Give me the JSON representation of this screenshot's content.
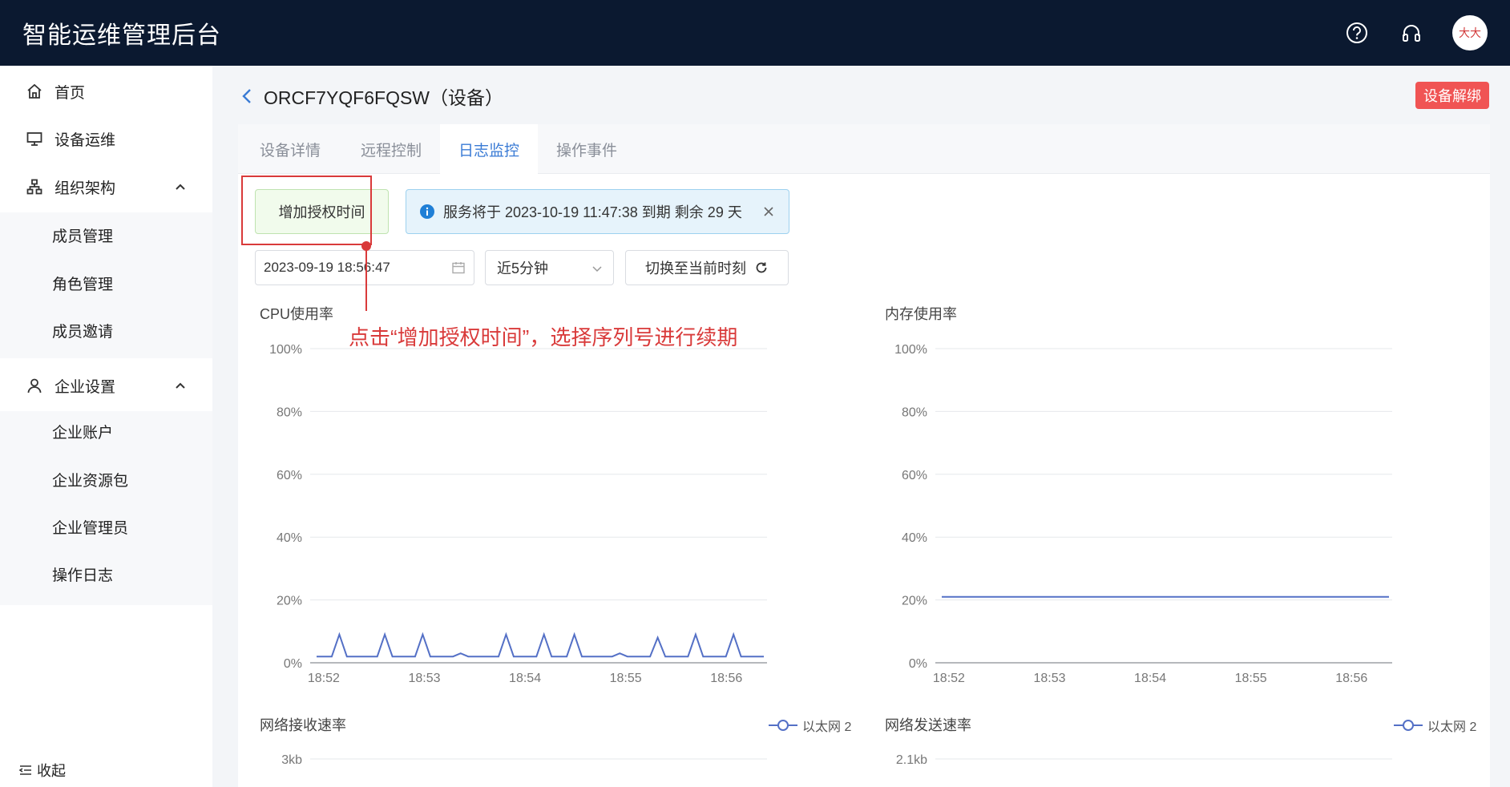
{
  "app": {
    "title": "智能运维管理后台",
    "avatar_text": "大大"
  },
  "topbar": {
    "icons": [
      "help-icon",
      "headset-icon"
    ]
  },
  "sidebar": {
    "items": [
      {
        "label": "首页",
        "icon": "home-icon"
      },
      {
        "label": "设备运维",
        "icon": "monitor-icon"
      },
      {
        "label": "组织架构",
        "icon": "org-icon",
        "expanded": true
      },
      {
        "label": "企业设置",
        "icon": "user-icon",
        "expanded": true
      }
    ],
    "org_children": [
      "成员管理",
      "角色管理",
      "成员邀请"
    ],
    "ent_children": [
      "企业账户",
      "企业资源包",
      "企业管理员",
      "操作日志"
    ],
    "collapse_label": "收起"
  },
  "header": {
    "title": "ORCF7YQF6FQSW（设备）",
    "unbind_label": "设备解绑"
  },
  "tabs": [
    {
      "label": "设备详情",
      "active": false
    },
    {
      "label": "远程控制",
      "active": false
    },
    {
      "label": "日志监控",
      "active": true
    },
    {
      "label": "操作事件",
      "active": false
    }
  ],
  "toolbar": {
    "add_auth_label": "增加授权时间",
    "notice_text": "服务将于 2023-10-19 11:47:38 到期 剩余 29 天",
    "date_value": "2023-09-19 18:56:47",
    "range_value": "近5分钟",
    "switch_label": "切换至当前时刻"
  },
  "annotation": {
    "text": "点击“增加授权时间”，选择序列号进行续期"
  },
  "chart_data": [
    {
      "type": "line",
      "title": "CPU使用率",
      "yticks": [
        "100%",
        "80%",
        "60%",
        "40%",
        "20%",
        "0%"
      ],
      "xticks": [
        "18:52",
        "18:53",
        "18:54",
        "18:55",
        "18:56"
      ],
      "ylim": [
        0,
        100
      ],
      "x": [
        "18:51:50",
        "18:51:55",
        "18:52:00",
        "18:52:05",
        "18:52:10",
        "18:52:15",
        "18:52:20",
        "18:52:25",
        "18:52:30",
        "18:52:35",
        "18:52:40",
        "18:52:45",
        "18:52:50",
        "18:52:55",
        "18:53:00",
        "18:53:05",
        "18:53:10",
        "18:53:15",
        "18:53:20",
        "18:53:25",
        "18:53:30",
        "18:53:35",
        "18:53:40",
        "18:53:45",
        "18:53:50",
        "18:53:55",
        "18:54:00",
        "18:54:05",
        "18:54:10",
        "18:54:15",
        "18:54:20",
        "18:54:25",
        "18:54:30",
        "18:54:35",
        "18:54:40",
        "18:54:45",
        "18:54:50",
        "18:54:55",
        "18:55:00",
        "18:55:05",
        "18:55:10",
        "18:55:15",
        "18:55:20",
        "18:55:25",
        "18:55:30",
        "18:55:35",
        "18:55:40",
        "18:55:45",
        "18:55:50",
        "18:55:55",
        "18:56:00",
        "18:56:05",
        "18:56:10",
        "18:56:15",
        "18:56:20",
        "18:56:25",
        "18:56:30",
        "18:56:35",
        "18:56:40",
        "18:56:45"
      ],
      "series": [
        {
          "values": [
            2,
            2,
            2,
            9,
            2,
            2,
            2,
            2,
            2,
            9,
            2,
            2,
            2,
            2,
            9,
            2,
            2,
            2,
            2,
            3,
            2,
            2,
            2,
            2,
            2,
            9,
            2,
            2,
            2,
            2,
            9,
            2,
            2,
            2,
            9,
            2,
            2,
            2,
            2,
            2,
            3,
            2,
            2,
            2,
            2,
            8,
            2,
            2,
            2,
            2,
            9,
            2,
            2,
            2,
            2,
            9,
            2,
            2,
            2,
            2
          ],
          "color": "#5470c6"
        }
      ],
      "grid": true
    },
    {
      "type": "line",
      "title": "内存使用率",
      "yticks": [
        "100%",
        "80%",
        "60%",
        "40%",
        "20%",
        "0%"
      ],
      "xticks": [
        "18:52",
        "18:53",
        "18:54",
        "18:55",
        "18:56"
      ],
      "ylim": [
        0,
        100
      ],
      "series": [
        {
          "values": [
            21,
            21
          ],
          "color": "#5470c6"
        }
      ],
      "grid": true
    },
    {
      "type": "line",
      "title": "网络接收速率",
      "yticks": [
        "3kb"
      ],
      "legend": [
        {
          "name": "以太网 2",
          "color": "#5470c6"
        }
      ],
      "legend_position": "top-right"
    },
    {
      "type": "line",
      "title": "网络发送速率",
      "yticks": [
        "2.1kb"
      ],
      "legend": [
        {
          "name": "以太网 2",
          "color": "#5470c6"
        }
      ],
      "legend_position": "top-right"
    }
  ]
}
